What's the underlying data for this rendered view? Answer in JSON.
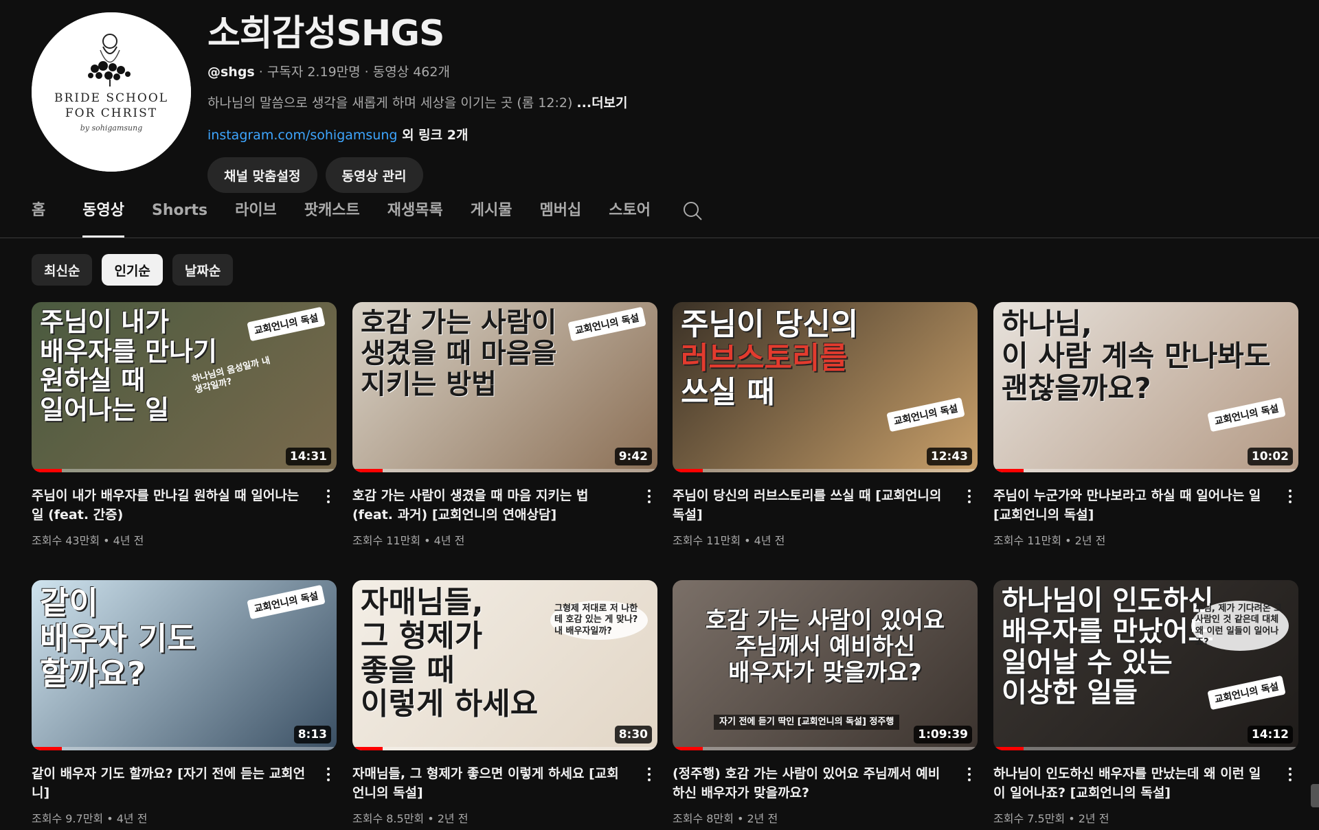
{
  "channel": {
    "name": "소희감성SHGS",
    "handle": "@shgs",
    "stats": " · 구독자 2.19만명 · 동영상 462개",
    "description": "하나님의 말씀으로 생각을 새롭게 하며 세상을 이기는 곳 (롬 12:2) ",
    "more_label": "...더보기",
    "link": "instagram.com/sohigamsung",
    "link_extra": " 외 링크 2개",
    "avatar_lines": [
      "BRIDE SCHOOL",
      "FOR CHRIST",
      "by sohigamsung"
    ],
    "buttons": {
      "customize": "채널 맞춤설정",
      "manage": "동영상 관리"
    }
  },
  "tabs": [
    "홈",
    "동영상",
    "Shorts",
    "라이브",
    "팟캐스트",
    "재생목록",
    "게시물",
    "멤버십",
    "스토어"
  ],
  "active_tab": "동영상",
  "chips": [
    "최신순",
    "인기순",
    "날짜순"
  ],
  "active_chip": "인기순",
  "videos": [
    {
      "title": "주님이 내가 배우자를 만나길 원하실 때 일어나는 일 (feat. 간증)",
      "meta": "조회수 43만회 • 4년 전",
      "duration": "14:31",
      "progress": 0.1,
      "thumb_text": [
        "주님이 내가",
        "배우자를 만나기",
        "원하실 때",
        "일어나는 일"
      ],
      "badge": "교회언니의 독설",
      "sub_text": "하나님의 음성일까 내 생각일까?",
      "bg": [
        "#4a5a3f",
        "#7a6a4d"
      ]
    },
    {
      "title": "호감 가는 사람이 생겼을 때 마음 지키는 법 (feat. 과거) [교회언니의 연애상담]",
      "meta": "조회수 11만회 • 4년 전",
      "duration": "9:42",
      "progress": 0.1,
      "thumb_text": [
        "호감 가는 사람이",
        "생겼을 때 마음을",
        "지키는 방법"
      ],
      "badge": "교회언니의 독설",
      "sub_text": "",
      "bg": [
        "#d9d3c8",
        "#8b6f55"
      ]
    },
    {
      "title": "주님이 당신의 러브스토리를 쓰실 때 [교회언니의 독설]",
      "meta": "조회수 11만회 • 4년 전",
      "duration": "12:43",
      "progress": 0.1,
      "thumb_text": [
        "주님이 당신의",
        "러브스토리를",
        "쓰실 때"
      ],
      "badge": "교회언니의 독설",
      "sub_text": "",
      "bg": [
        "#3a3126",
        "#c9a06a"
      ]
    },
    {
      "title": "주님이 누군가와 만나보라고 하실 때 일어나는 일 [교회언니의 독설]",
      "meta": "조회수 11만회 • 2년 전",
      "duration": "10:02",
      "progress": 0.1,
      "thumb_text": [
        "하나님,",
        "이 사람 계속 만나봐도",
        "괜찮을까요?"
      ],
      "badge": "교회언니의 독설",
      "sub_text": "",
      "bg": [
        "#e7e2dc",
        "#b49a85"
      ]
    },
    {
      "title": "같이 배우자 기도 할까요? [자기 전에 듣는 교회언니]",
      "meta": "조회수 9.7만회 • 4년 전",
      "duration": "8:13",
      "progress": 0.1,
      "thumb_text": [
        "같이",
        "배우자 기도",
        "할까요?"
      ],
      "badge": "교회언니의 독설",
      "sub_text": "",
      "bg": [
        "#cfe3ee",
        "#3a4f63"
      ]
    },
    {
      "title": "자매님들, 그 형제가 좋으면 이렇게 하세요 [교회언니의 독설]",
      "meta": "조회수 8.5만회 • 2년 전",
      "duration": "8:30",
      "progress": 0.1,
      "thumb_text": [
        "자매님들,",
        "그 형제가",
        "좋을 때",
        "이렇게 하세요"
      ],
      "badge": "",
      "sub_text": "그형제 저대로 저 나한테 호감 있는 게 맞나? 내 배우자일까?",
      "bg": [
        "#f3eee6",
        "#e2d6c6"
      ]
    },
    {
      "title": "(정주행) 호감 가는 사람이 있어요 주님께서 예비하신 배우자가 맞을까요?",
      "meta": "조회수 8만회 • 2년 전",
      "duration": "1:09:39",
      "progress": 0.1,
      "thumb_text": [
        "호감 가는 사람이 있어요",
        "주님께서 예비하신",
        "배우자가 맞을까요?"
      ],
      "badge": "",
      "sub_text": "자기 전에 듣기 딱인 [교회언니의 독설] 정주행",
      "bg": [
        "#7b7068",
        "#3b332e"
      ]
    },
    {
      "title": "하나님이 인도하신 배우자를 만났는데 왜 이런 일이 일어나죠? [교회언니의 독설]",
      "meta": "조회수 7.5만회 • 2년 전",
      "duration": "14:12",
      "progress": 0.1,
      "thumb_text": [
        "하나님이 인도하신",
        "배우자를 만났어도",
        "일어날 수 있는",
        "이상한 일들"
      ],
      "badge": "교회언니의 독설",
      "sub_text": "주님, 제가 기다려온 그 사람인 것 같은데 대체 왜 이런 일들이 일어나죠?",
      "bg": [
        "#3b3632",
        "#1f1c1a"
      ]
    }
  ]
}
